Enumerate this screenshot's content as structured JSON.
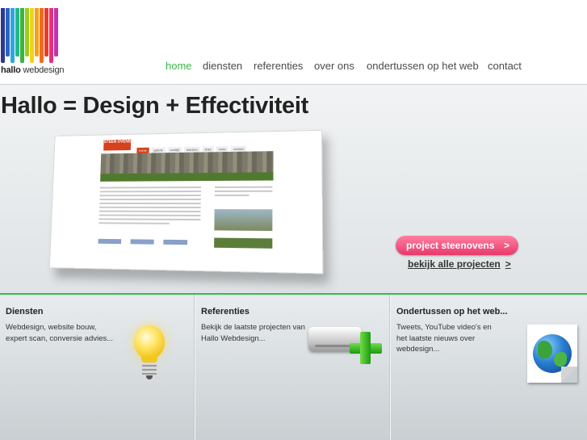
{
  "header": {
    "logo": {
      "text_bold": "hallo",
      "text_rest": " webdesign",
      "bar_colors": [
        "#2b3a8c",
        "#2d62c4",
        "#2aa6e0",
        "#26b88a",
        "#3cb63a",
        "#9ccc24",
        "#f0d417",
        "#f5a21a",
        "#ef6b1d",
        "#e93a2c",
        "#e72f7c",
        "#c233b0"
      ]
    },
    "nav": [
      {
        "label": "home",
        "active": true
      },
      {
        "label": "diensten",
        "active": false
      },
      {
        "label": "referenties",
        "active": false
      },
      {
        "label": "over ons",
        "active": false
      },
      {
        "label": "ondertussen op het web",
        "active": false
      },
      {
        "label": "contact",
        "active": false
      }
    ]
  },
  "hero": {
    "title": "Hallo = Design + Effectiviteit",
    "cta_label": "project steenovens",
    "cta_arrow": ">",
    "all_projects_label": "bekijk alle projecten",
    "all_projects_arrow": ">",
    "screenshot": {
      "logo_text": "STEEN OVENS",
      "nav": [
        "home",
        "galerie",
        "verblijf",
        "dranken",
        "links",
        "route",
        "contact"
      ]
    }
  },
  "columns": [
    {
      "title": "Diensten",
      "text": [
        "Webdesign, website bouw,",
        "expert scan, conversie advies..."
      ]
    },
    {
      "title": "Referenties",
      "text": [
        "Bekijk de laatste projecten van",
        "Hallo Webdesign..."
      ]
    },
    {
      "title": "Ondertussen op het web...",
      "text": [
        "Tweets, YouTube video's en",
        "het laatste nieuws over",
        "webdesign..."
      ]
    }
  ],
  "colors": {
    "nav_active": "#39b54a",
    "cta": "#e83a6a",
    "divider_green": "#2fbf4a"
  },
  "icons": {
    "diensten": "lightbulb-icon",
    "referenties": "add-drive-icon",
    "ondertussen": "globe-document-icon"
  }
}
